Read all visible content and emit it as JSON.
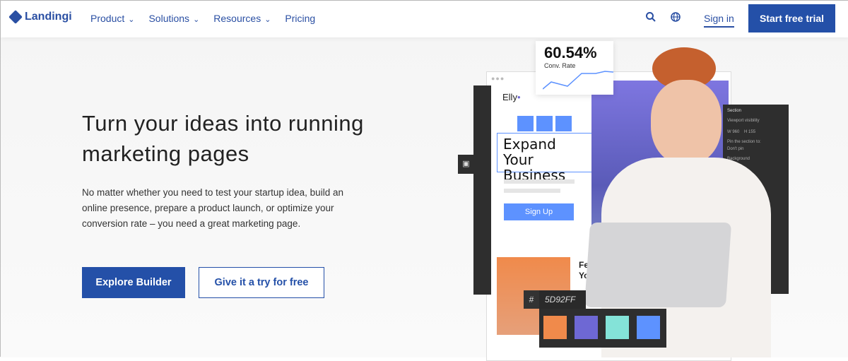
{
  "nav": {
    "brand": "Landingi",
    "menu": [
      {
        "label": "Product"
      },
      {
        "label": "Solutions"
      },
      {
        "label": "Resources"
      },
      {
        "label": "Pricing"
      }
    ],
    "sign_in": "Sign in",
    "start_trial": "Start free trial"
  },
  "hero": {
    "title": "Turn your ideas into running marketing pages",
    "description": "No matter whether you need to test your startup idea, build an online presence, prepare a product launch, or optimize your conversion rate – you need a great marketing page.",
    "explore": "Explore Builder",
    "try": "Give it a try for free"
  },
  "illustration": {
    "rate": "60.54%",
    "rate_label": "Conv. Rate",
    "brand": "Elly",
    "headline": "Expand Your Business",
    "signup": "Sign Up",
    "feature_text": "Few\nYou",
    "hash": "#",
    "color_hex": "5D92FF",
    "swatches": [
      "#f08a4b",
      "#6e68d4",
      "#84e3d8",
      "#5d92ff"
    ],
    "panel": {
      "title": "Section",
      "viewport": "Viewport visibility",
      "w": "960",
      "h": "155",
      "pin_label": "Pin the section to:",
      "pin_value": "Don't pin",
      "background": "Background"
    }
  }
}
